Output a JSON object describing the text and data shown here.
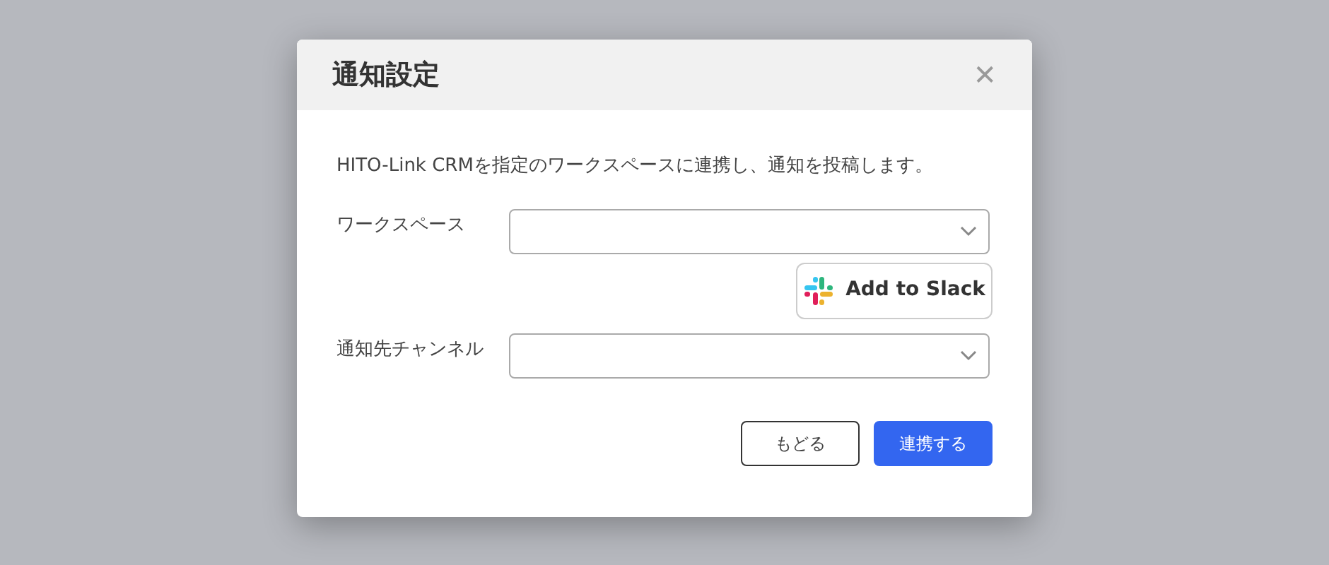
{
  "dialog": {
    "title": "通知設定",
    "close": "✕",
    "description": "HITO-Link CRMを指定のワークスペースに連携し、通知を投稿します。",
    "fields": [
      {
        "label": "ワークスペース",
        "kind": "select",
        "slack_button": "Add to Slack"
      },
      {
        "label": "通知先チャンネル",
        "kind": "select"
      }
    ],
    "buttons": [
      {
        "label": "もどる",
        "kind": "secondary"
      },
      {
        "label": "連携する",
        "kind": "primary"
      }
    ]
  }
}
